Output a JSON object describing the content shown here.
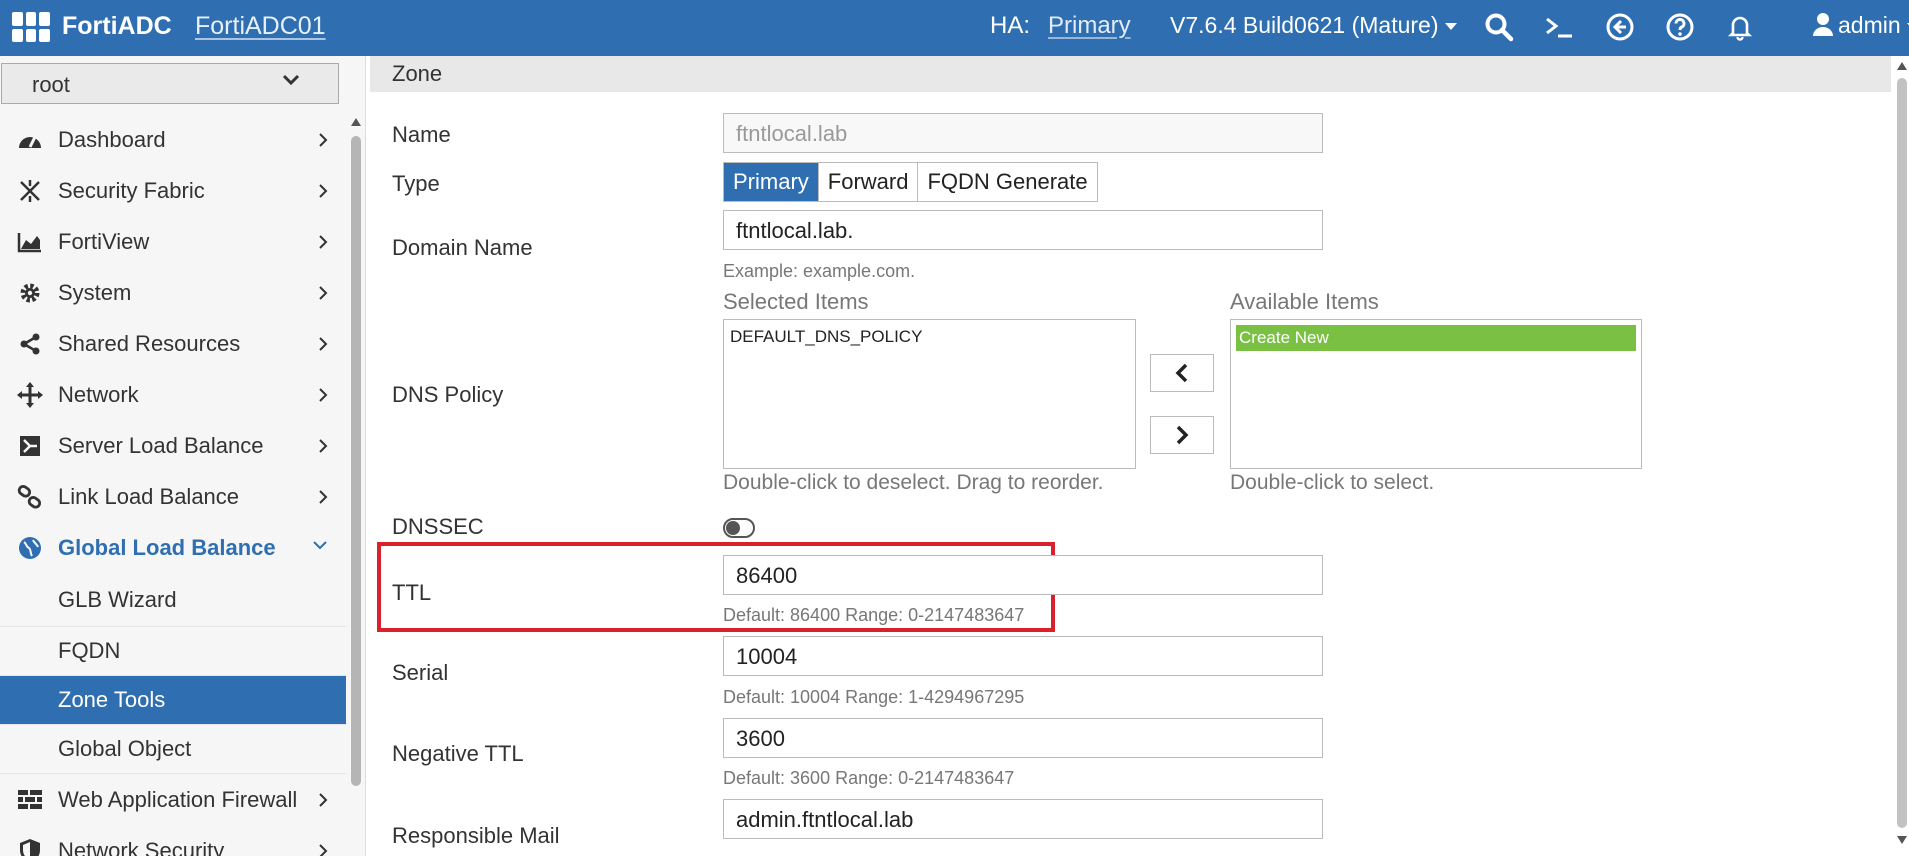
{
  "header": {
    "brand": "FortiADC",
    "device": "FortiADC01",
    "ha_label": "HA:",
    "ha_value": "Primary",
    "version": "V7.6.4 Build0621 (Mature)",
    "user": "admin",
    "accent": "#2f6fb1"
  },
  "sidebar": {
    "vdom": "root",
    "items": [
      {
        "label": "Dashboard",
        "icon": "dashboard-icon"
      },
      {
        "label": "Security Fabric",
        "icon": "security-fabric-icon"
      },
      {
        "label": "FortiView",
        "icon": "fortiview-icon"
      },
      {
        "label": "System",
        "icon": "gear-icon"
      },
      {
        "label": "Shared Resources",
        "icon": "share-icon"
      },
      {
        "label": "Network",
        "icon": "network-icon"
      },
      {
        "label": "Server Load Balance",
        "icon": "server-lb-icon"
      },
      {
        "label": "Link Load Balance",
        "icon": "link-icon"
      },
      {
        "label": "Global Load Balance",
        "icon": "globe-icon"
      },
      {
        "label": "Web Application Firewall",
        "icon": "firewall-icon"
      },
      {
        "label": "Network Security",
        "icon": "shield-icon"
      }
    ],
    "sub_items": [
      "GLB Wizard",
      "FQDN",
      "Zone Tools",
      "Global Object"
    ],
    "active_sub": "Zone Tools"
  },
  "main": {
    "section": "Zone",
    "name_label": "Name",
    "name_value": "ftntlocal.lab",
    "type_label": "Type",
    "type_options": [
      "Primary",
      "Forward",
      "FQDN Generate"
    ],
    "type_selected": "Primary",
    "domain_label": "Domain Name",
    "domain_value": "ftntlocal.lab.",
    "domain_hint": "Example: example.com.",
    "dns_policy_label": "DNS Policy",
    "selected_title": "Selected Items",
    "selected_items": [
      "DEFAULT_DNS_POLICY"
    ],
    "selected_hint": "Double-click to deselect. Drag to reorder.",
    "available_title": "Available Items",
    "available_items": [
      "Create New"
    ],
    "available_hint": "Double-click to select.",
    "dnssec_label": "DNSSEC",
    "ttl_label": "TTL",
    "ttl_value": "86400",
    "ttl_hint": "Default: 86400 Range: 0-2147483647",
    "serial_label": "Serial",
    "serial_value": "10004",
    "serial_hint": "Default: 10004 Range: 1-4294967295",
    "neg_ttl_label": "Negative TTL",
    "neg_ttl_value": "3600",
    "neg_ttl_hint": "Default: 3600 Range: 0-2147483647",
    "mail_label": "Responsible Mail",
    "mail_value": "admin.ftntlocal.lab",
    "highlight_color": "#d9202b",
    "selected_bg": "#7ac143"
  }
}
